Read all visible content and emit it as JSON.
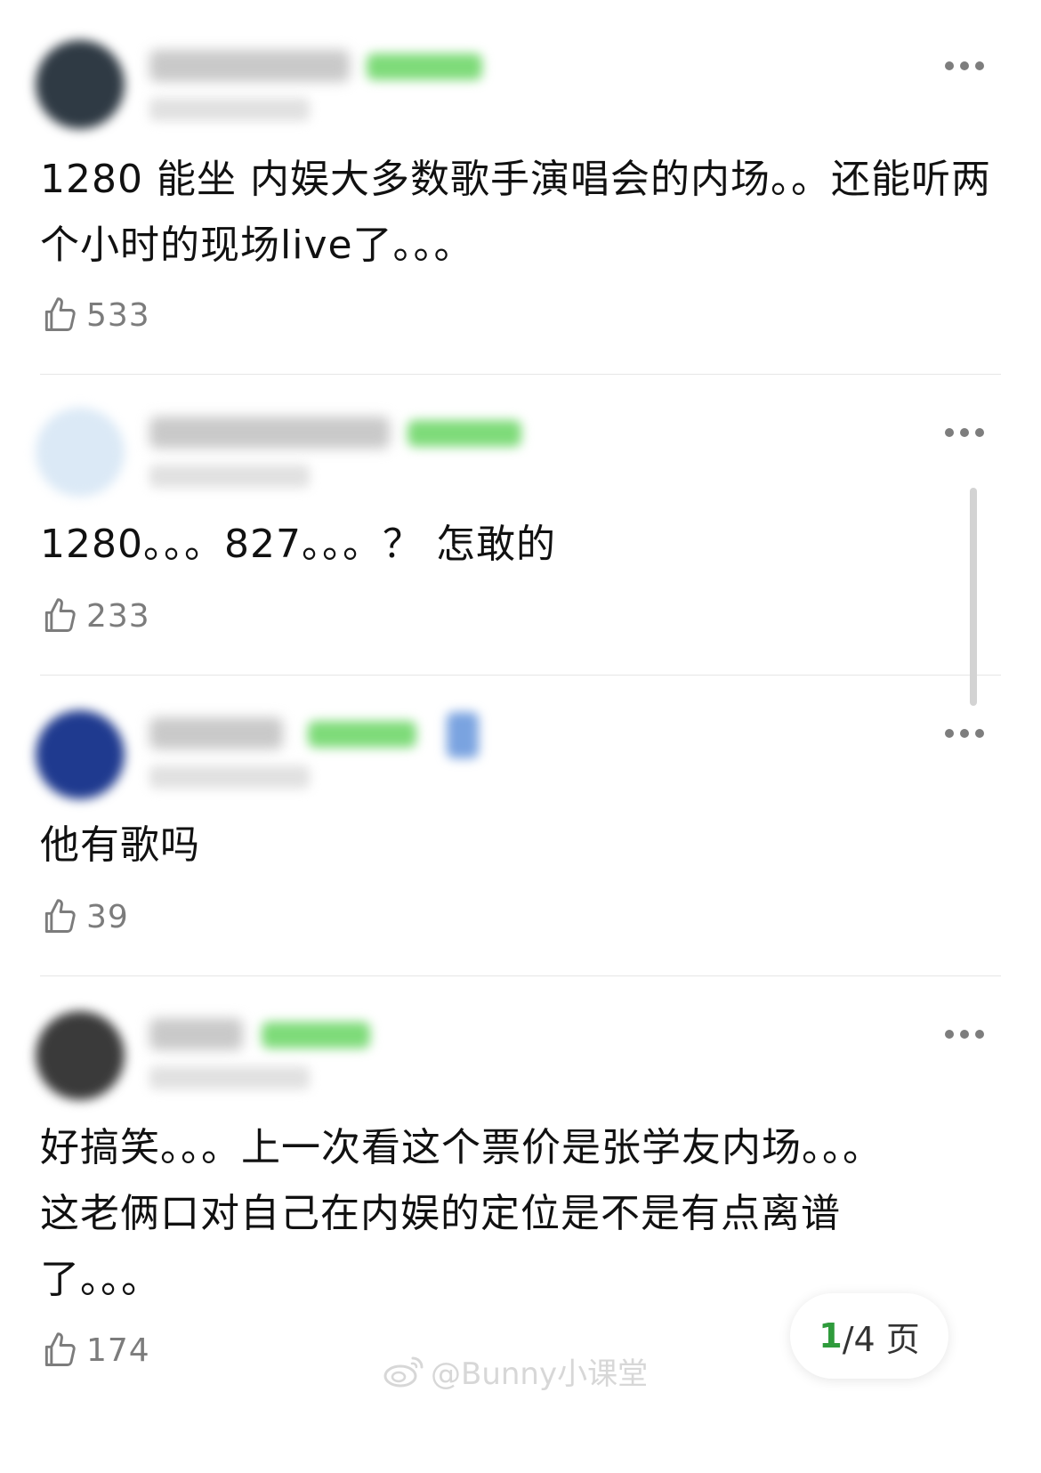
{
  "comments": [
    {
      "text": "1280 能坐 内娱大多数歌手演唱会的内场。。还能听两个小时的现场live了。。。",
      "likes": "533",
      "avatar_color": "#2f3a44"
    },
    {
      "text": "1280。。。827。。。？ 怎敢的",
      "likes": "233",
      "avatar_color": "#dbe9f6"
    },
    {
      "text": "他有歌吗",
      "likes": "39",
      "avatar_color": "#1f3a8f"
    },
    {
      "text": "好搞笑。。。上一次看这个票价是张学友内场。。。这老俩口对自己在内娱的定位是不是有点离谱了。。。",
      "likes": "174",
      "avatar_color": "#3a3a3a"
    }
  ],
  "pager": {
    "current": "1",
    "rest": "/4 页"
  },
  "watermark": "@Bunny小课堂",
  "colors": {
    "badge_green": "#7edb79",
    "pager_current": "#2f9b3c",
    "like_gray": "#7c7c7c"
  },
  "icons": {
    "more": "more-dots-icon",
    "like": "thumbs-up-icon",
    "watermark": "weibo-logo-icon"
  }
}
